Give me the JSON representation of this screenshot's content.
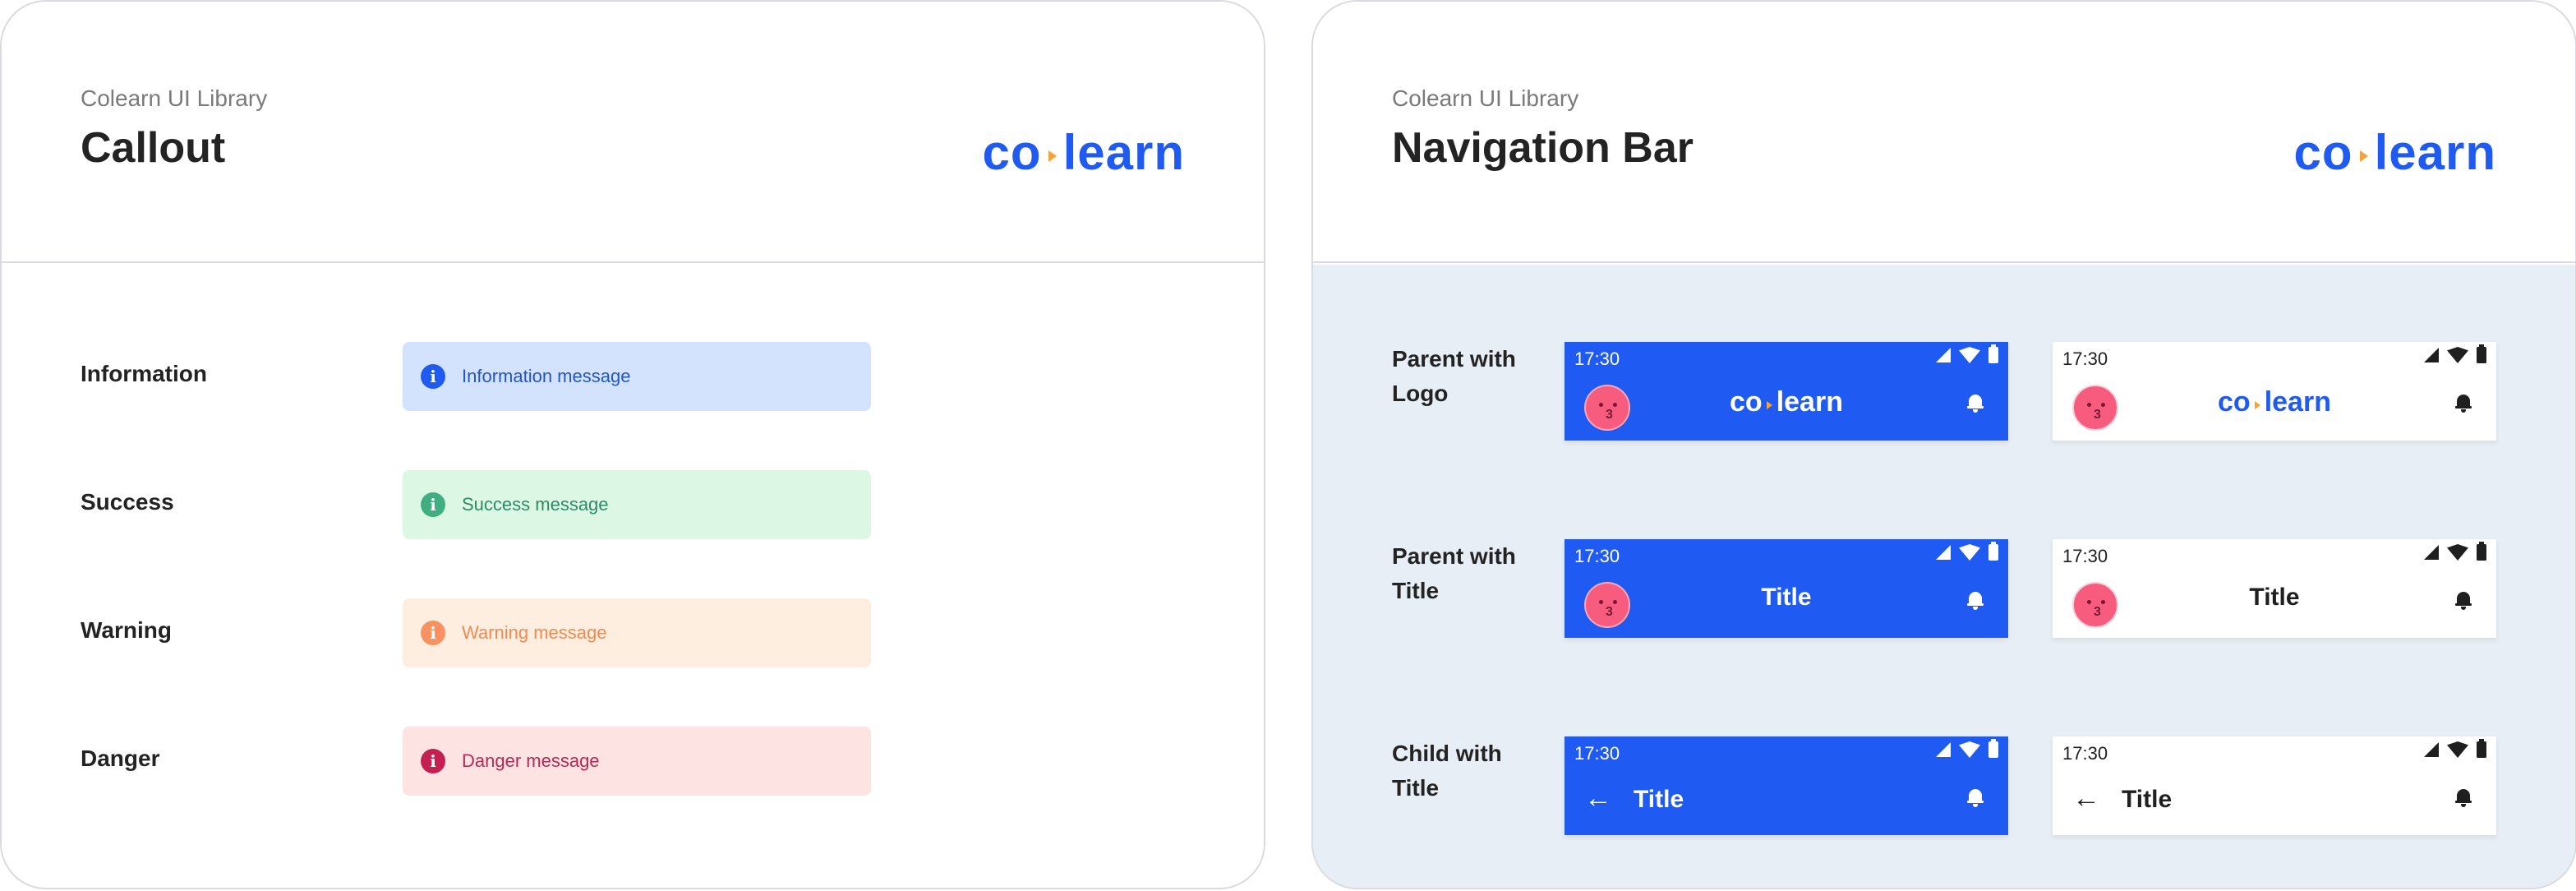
{
  "library_label": "Colearn UI Library",
  "logo": {
    "left": "co",
    "right": "learn",
    "accent_color": "#f2a33a",
    "brand_color": "#1f5af2"
  },
  "callout_card": {
    "title": "Callout",
    "rows": [
      {
        "label": "Information",
        "message": "Information message",
        "variant": "info",
        "icon": "info-icon"
      },
      {
        "label": "Success",
        "message": "Success message",
        "variant": "success",
        "icon": "info-icon"
      },
      {
        "label": "Warning",
        "message": "Warning message",
        "variant": "warning",
        "icon": "info-icon"
      },
      {
        "label": "Danger",
        "message": "Danger message",
        "variant": "danger",
        "icon": "info-icon"
      }
    ]
  },
  "navbar_card": {
    "title": "Navigation Bar",
    "rows": [
      {
        "label_line1": "Parent with",
        "label_line2": "Logo",
        "time": "17:30",
        "logo_left": "co",
        "logo_right": "learn"
      },
      {
        "label_line1": "Parent with",
        "label_line2": "Title",
        "time": "17:30",
        "title": "Title"
      },
      {
        "label_line1": "Child with",
        "label_line2": "Title",
        "time": "17:30",
        "title": "Title",
        "back_icon": "←"
      }
    ],
    "themes": [
      "blue",
      "white"
    ]
  },
  "colors": {
    "primary_blue": "#1f5af2",
    "background_grey": "#e8eef6",
    "avatar_pink": "#f75c7f"
  }
}
